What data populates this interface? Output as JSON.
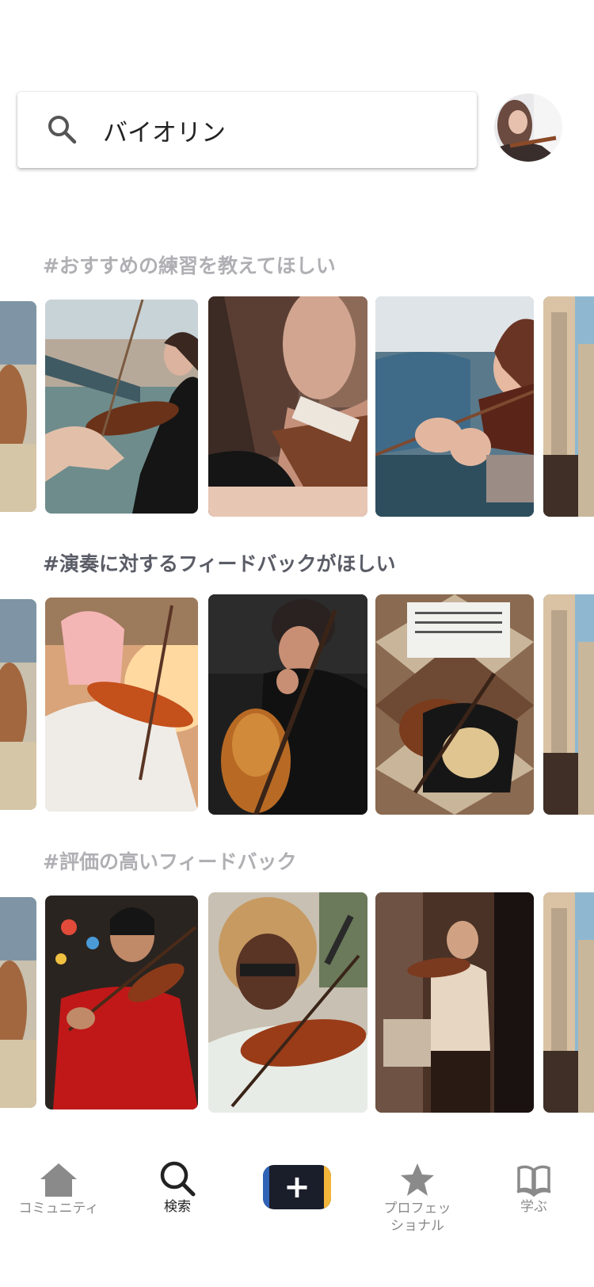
{
  "search": {
    "value": "バイオリン",
    "icon": "search-icon"
  },
  "avatar": {
    "icon": "user-avatar"
  },
  "sections": [
    {
      "title": "#おすすめの練習を教えてほしい",
      "title_color": "#b0b0b4"
    },
    {
      "title": "#演奏に対するフィードバックがほしい",
      "title_color": "#5a5c66"
    },
    {
      "title": "#評価の高いフィードバック",
      "title_color": "#b0b0b4"
    }
  ],
  "tabbar": {
    "items": [
      {
        "label": "コミュニティ",
        "icon": "home-icon",
        "active": false
      },
      {
        "label": "検索",
        "icon": "search-icon",
        "active": true
      },
      {
        "label": "",
        "icon": "plus-icon",
        "active": false
      },
      {
        "label": "プロフェッ",
        "label2": "ショナル",
        "icon": "star-icon",
        "active": false
      },
      {
        "label": "学ぶ",
        "icon": "book-icon",
        "active": false
      }
    ],
    "plus_symbol": "+"
  },
  "colors": {
    "active": "#222222",
    "inactive": "#8a8a8a",
    "plus_bg": "#1a1d2a",
    "plus_left": "#2f63b7",
    "plus_right": "#f4b63a"
  }
}
